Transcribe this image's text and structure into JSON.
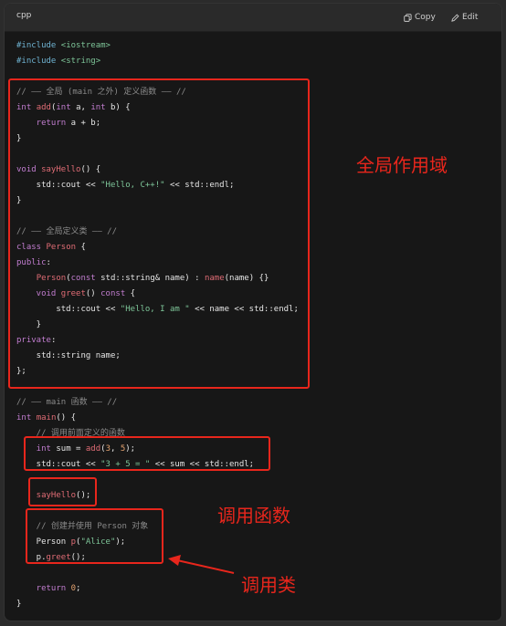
{
  "header": {
    "language": "cpp",
    "copy_label": "Copy",
    "edit_label": "Edit"
  },
  "code": {
    "lines": [
      [
        {
          "t": "#include ",
          "c": "pp"
        },
        {
          "t": "<iostream>",
          "c": "inc"
        }
      ],
      [
        {
          "t": "#include ",
          "c": "pp"
        },
        {
          "t": "<string>",
          "c": "inc"
        }
      ],
      [],
      [
        {
          "t": "// —— 全局 (main 之外) 定义函数 —— //",
          "c": "cm"
        }
      ],
      [
        {
          "t": "int ",
          "c": "type"
        },
        {
          "t": "add",
          "c": "fn"
        },
        {
          "t": "(",
          "c": "punct"
        },
        {
          "t": "int ",
          "c": "type"
        },
        {
          "t": "a, ",
          "c": "punct"
        },
        {
          "t": "int ",
          "c": "type"
        },
        {
          "t": "b) {",
          "c": "punct"
        }
      ],
      [
        {
          "t": "    return ",
          "c": "kw"
        },
        {
          "t": "a + b;",
          "c": "punct"
        }
      ],
      [
        {
          "t": "}",
          "c": "punct"
        }
      ],
      [],
      [
        {
          "t": "void ",
          "c": "type"
        },
        {
          "t": "sayHello",
          "c": "fn"
        },
        {
          "t": "() {",
          "c": "punct"
        }
      ],
      [
        {
          "t": "    std::cout << ",
          "c": "punct"
        },
        {
          "t": "\"Hello, C++!\"",
          "c": "str"
        },
        {
          "t": " << std::endl;",
          "c": "punct"
        }
      ],
      [
        {
          "t": "}",
          "c": "punct"
        }
      ],
      [],
      [
        {
          "t": "// —— 全局定义类 —— //",
          "c": "cm"
        }
      ],
      [
        {
          "t": "class ",
          "c": "kw"
        },
        {
          "t": "Person",
          "c": "fn"
        },
        {
          "t": " {",
          "c": "punct"
        }
      ],
      [
        {
          "t": "public",
          "c": "kw"
        },
        {
          "t": ":",
          "c": "punct"
        }
      ],
      [
        {
          "t": "    ",
          "c": "punct"
        },
        {
          "t": "Person",
          "c": "fn"
        },
        {
          "t": "(",
          "c": "punct"
        },
        {
          "t": "const ",
          "c": "kw"
        },
        {
          "t": "std::string& name) : ",
          "c": "punct"
        },
        {
          "t": "name",
          "c": "fn"
        },
        {
          "t": "(name) {}",
          "c": "punct"
        }
      ],
      [
        {
          "t": "    void ",
          "c": "type"
        },
        {
          "t": "greet",
          "c": "fn"
        },
        {
          "t": "() ",
          "c": "punct"
        },
        {
          "t": "const",
          "c": "kw"
        },
        {
          "t": " {",
          "c": "punct"
        }
      ],
      [
        {
          "t": "        std::cout << ",
          "c": "punct"
        },
        {
          "t": "\"Hello, I am \"",
          "c": "str"
        },
        {
          "t": " << name << std::endl;",
          "c": "punct"
        }
      ],
      [
        {
          "t": "    }",
          "c": "punct"
        }
      ],
      [
        {
          "t": "private",
          "c": "kw"
        },
        {
          "t": ":",
          "c": "punct"
        }
      ],
      [
        {
          "t": "    std::string name;",
          "c": "punct"
        }
      ],
      [
        {
          "t": "};",
          "c": "punct"
        }
      ],
      [],
      [
        {
          "t": "// —— main 函数 —— //",
          "c": "cm"
        }
      ],
      [
        {
          "t": "int ",
          "c": "type"
        },
        {
          "t": "main",
          "c": "fn"
        },
        {
          "t": "() {",
          "c": "punct"
        }
      ],
      [
        {
          "t": "    // 调用前面定义的函数",
          "c": "cm"
        }
      ],
      [
        {
          "t": "    int ",
          "c": "type"
        },
        {
          "t": "sum = ",
          "c": "punct"
        },
        {
          "t": "add",
          "c": "fn"
        },
        {
          "t": "(",
          "c": "punct"
        },
        {
          "t": "3",
          "c": "num"
        },
        {
          "t": ", ",
          "c": "punct"
        },
        {
          "t": "5",
          "c": "num"
        },
        {
          "t": ");",
          "c": "punct"
        }
      ],
      [
        {
          "t": "    std::cout << ",
          "c": "punct"
        },
        {
          "t": "\"3 + 5 = \"",
          "c": "str"
        },
        {
          "t": " << sum << std::endl;",
          "c": "punct"
        }
      ],
      [],
      [
        {
          "t": "    sayHello",
          "c": "fn"
        },
        {
          "t": "();",
          "c": "punct"
        }
      ],
      [],
      [
        {
          "t": "    // 创建并使用 Person 对象",
          "c": "cm"
        }
      ],
      [
        {
          "t": "    Person ",
          "c": "punct"
        },
        {
          "t": "p",
          "c": "fn"
        },
        {
          "t": "(",
          "c": "punct"
        },
        {
          "t": "\"Alice\"",
          "c": "str"
        },
        {
          "t": ");",
          "c": "punct"
        }
      ],
      [
        {
          "t": "    p.",
          "c": "punct"
        },
        {
          "t": "greet",
          "c": "fn"
        },
        {
          "t": "();",
          "c": "punct"
        }
      ],
      [],
      [
        {
          "t": "    return ",
          "c": "kw"
        },
        {
          "t": "0",
          "c": "num"
        },
        {
          "t": ";",
          "c": "punct"
        }
      ],
      [
        {
          "t": "}",
          "c": "punct"
        }
      ]
    ]
  },
  "annotations": {
    "global_scope": "全局作用域",
    "call_function": "调用函数",
    "call_class": "调用类"
  },
  "colors": {
    "annotation_red": "#e8261c",
    "background": "#171717",
    "string": "#7ec699",
    "keyword": "#c27dd0",
    "function": "#e06c75",
    "number": "#e3a26f",
    "comment": "#8a8a8a"
  }
}
